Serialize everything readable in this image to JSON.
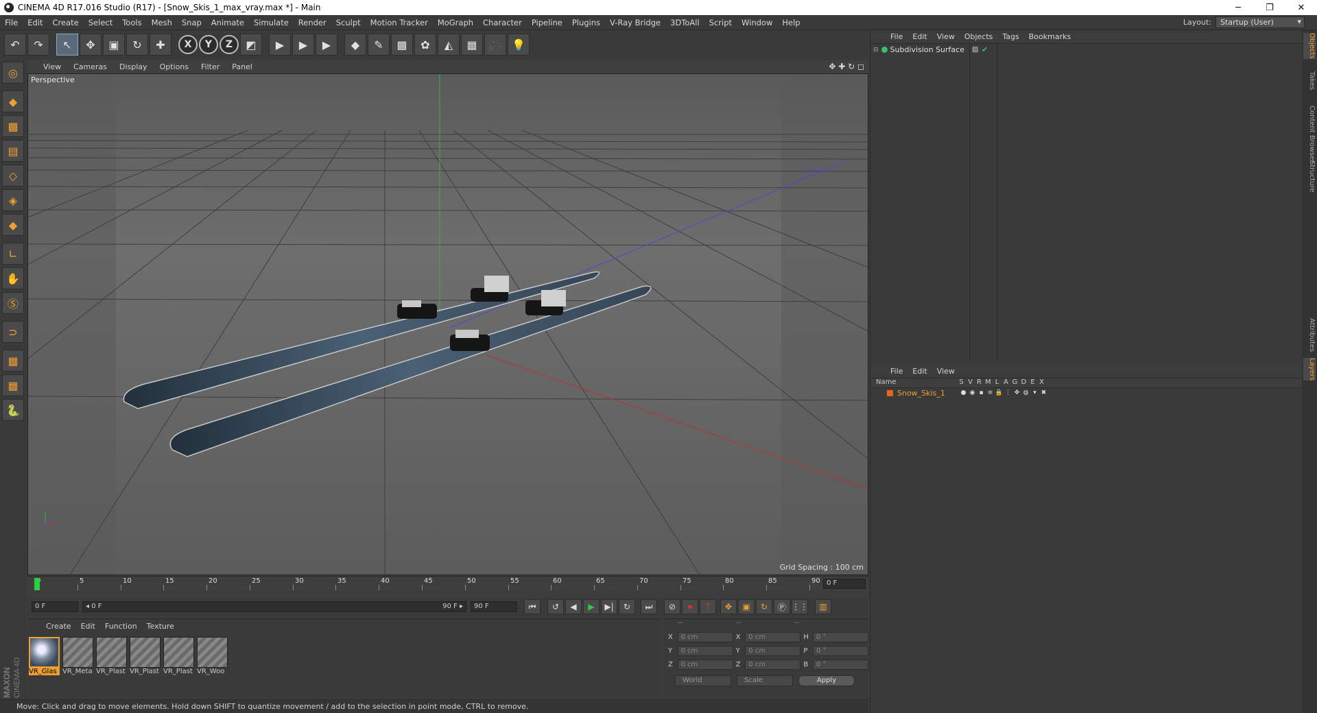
{
  "window": {
    "title": "CINEMA 4D R17.016 Studio (R17) - [Snow_Skis_1_max_vray.max *] - Main",
    "minimize": "─",
    "restore": "❐",
    "close": "✕"
  },
  "menubar": {
    "items": [
      "File",
      "Edit",
      "Create",
      "Select",
      "Tools",
      "Mesh",
      "Snap",
      "Animate",
      "Simulate",
      "Render",
      "Sculpt",
      "Motion Tracker",
      "MoGraph",
      "Character",
      "Pipeline",
      "Plugins",
      "V-Ray Bridge",
      "3DToAll",
      "Script",
      "Window",
      "Help"
    ],
    "layout_label": "Layout:",
    "layout_value": "Startup (User)"
  },
  "toolbar": {
    "undo": "↶",
    "redo": "↷",
    "select": "↖",
    "move": "✥",
    "scale": "▣",
    "rotate": "↻",
    "last_tool": "✚",
    "x_axis": "X",
    "y_axis": "Y",
    "z_axis": "Z",
    "coord_system": "◩",
    "render_view": "▶",
    "render_active": "▶",
    "render_settings": "▶",
    "cube": "◆",
    "pen": "✎",
    "subdivide": "▩",
    "cloner": "✿",
    "deformer": "◭",
    "floor": "▦",
    "camera": "🎥",
    "light": "💡"
  },
  "viewport": {
    "menu": [
      "View",
      "Cameras",
      "Display",
      "Options",
      "Filter",
      "Panel"
    ],
    "nav_icons": "✥ ✚ ↻ ◻",
    "label": "Perspective",
    "grid_spacing": "Grid Spacing : 100 cm"
  },
  "timeline": {
    "ticks": [
      "0",
      "5",
      "10",
      "15",
      "20",
      "25",
      "30",
      "35",
      "40",
      "45",
      "50",
      "55",
      "60",
      "65",
      "70",
      "75",
      "80",
      "85",
      "90"
    ],
    "current_frame": "0 F"
  },
  "playback": {
    "start": "0 F",
    "range_start": "◂ 0 F",
    "range_end": "90 F ▸",
    "end": "90 F",
    "buttons": [
      "⏮",
      "◀◀",
      "◀",
      "▶",
      "▶|",
      "▶▶",
      "⏭"
    ]
  },
  "materials": {
    "menu": [
      "Create",
      "Edit",
      "Function",
      "Texture"
    ],
    "items": [
      "VR_Glas",
      "VR_Meta",
      "VR_Plast",
      "VR_Plast",
      "VR_Plast",
      "VR_Woo"
    ]
  },
  "coordinates": {
    "header": [
      "--",
      "--",
      "--"
    ],
    "rows": [
      {
        "l1": "X",
        "v1": "0 cm",
        "l2": "X",
        "v2": "0 cm",
        "l3": "H",
        "v3": "0 °"
      },
      {
        "l1": "Y",
        "v1": "0 cm",
        "l2": "Y",
        "v2": "0 cm",
        "l3": "P",
        "v3": "0 °"
      },
      {
        "l1": "Z",
        "v1": "0 cm",
        "l2": "Z",
        "v2": "0 cm",
        "l3": "B",
        "v3": "0 °"
      }
    ],
    "mode": "World",
    "scale": "Scale",
    "apply": "Apply"
  },
  "status": "Move: Click and drag to move elements. Hold down SHIFT to quantize movement / add to the selection in point mode, CTRL to remove.",
  "objects_panel": {
    "menu": [
      "File",
      "Edit",
      "View",
      "Objects",
      "Tags",
      "Bookmarks"
    ],
    "object_name": "Subdivision Surface"
  },
  "layers_panel": {
    "menu": [
      "File",
      "Edit",
      "View"
    ],
    "columns": [
      "Name",
      "S",
      "V",
      "R",
      "M",
      "L",
      "A",
      "G",
      "D",
      "E",
      "X"
    ],
    "layer_name": "Snow_Skis_1"
  },
  "side_tabs": [
    "Objects",
    "Takes",
    "Content Browser",
    "Structure",
    "Attributes",
    "Layers"
  ],
  "branding": {
    "maxon": "MAXON",
    "cinema": "CINEMA 4D"
  }
}
